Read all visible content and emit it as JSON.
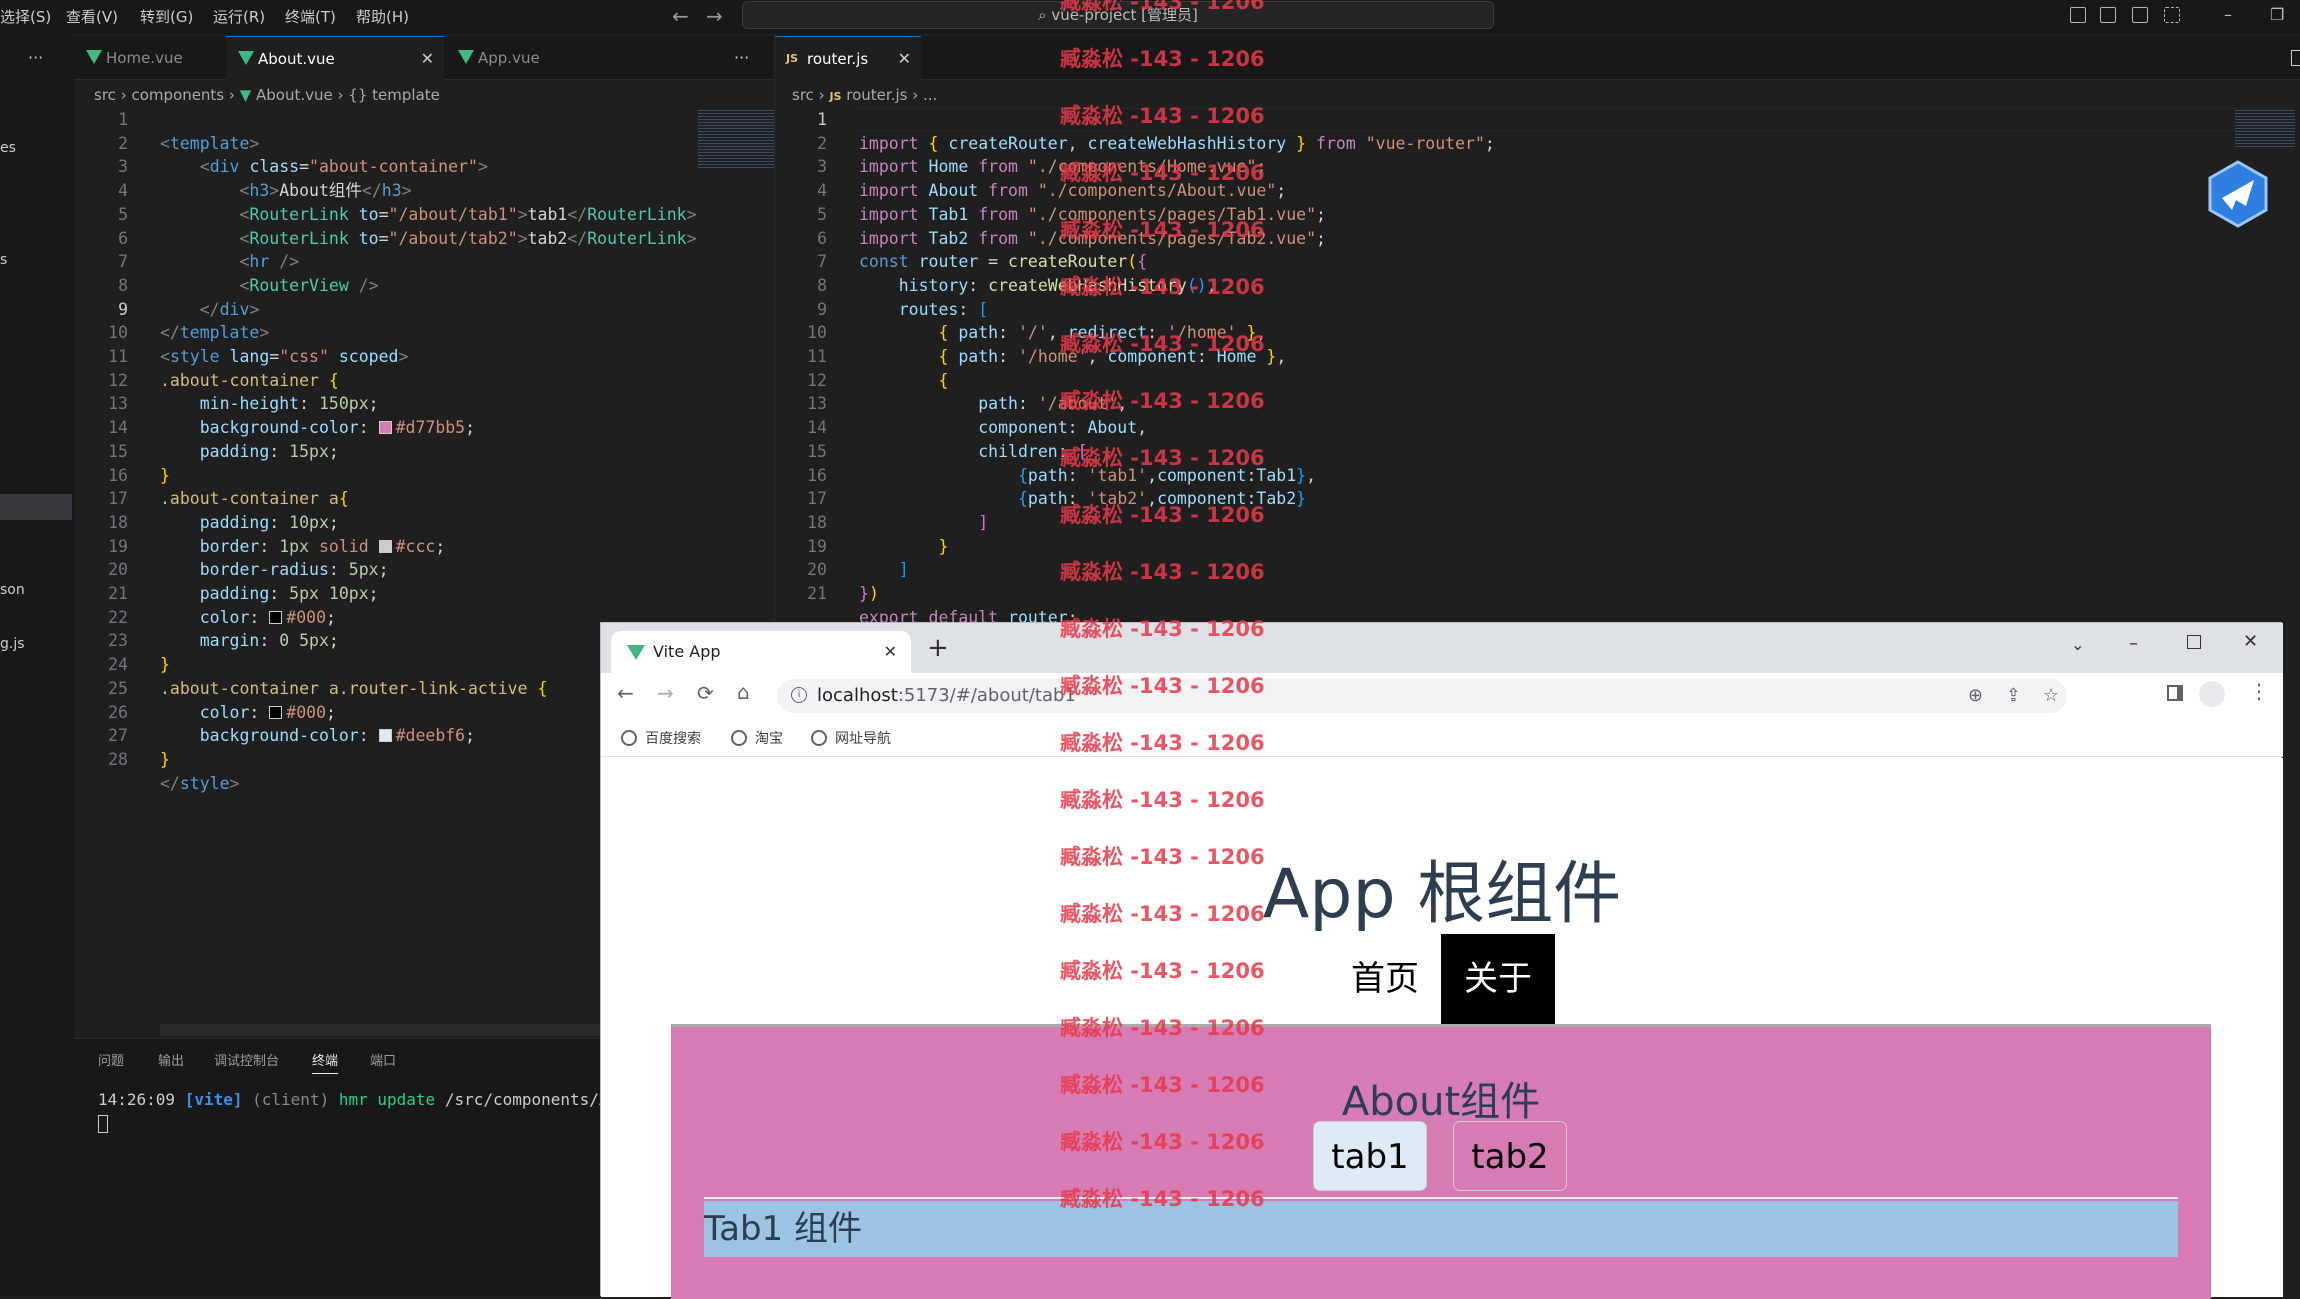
{
  "menu": {
    "items": [
      "选择(S)",
      "查看(V)",
      "转到(G)",
      "运行(R)",
      "终端(T)",
      "帮助(H)"
    ],
    "command_center": "vue-project [管理员]"
  },
  "left_editor": {
    "tabs": [
      {
        "label": "Home.vue"
      },
      {
        "label": "About.vue"
      },
      {
        "label": "App.vue"
      }
    ],
    "breadcrumb": {
      "p1": "src",
      "p2": "components",
      "p3": "About.vue",
      "p4": "{} template"
    },
    "lines": [
      "1",
      "2",
      "3",
      "4",
      "5",
      "6",
      "7",
      "8",
      "9",
      "10",
      "11",
      "12",
      "13",
      "14",
      "15",
      "16",
      "17",
      "18",
      "19",
      "20",
      "21",
      "22",
      "23",
      "24",
      "25",
      "26",
      "27",
      "28"
    ],
    "colors": {
      "about_bg": "#d77bb5",
      "border": "#ccc",
      "text": "#000",
      "active_bg": "#deebf6"
    }
  },
  "right_editor": {
    "tab": "router.js",
    "breadcrumb": {
      "p1": "src",
      "p2": "router.js",
      "p3": "..."
    },
    "lines": [
      "1",
      "2",
      "3",
      "4",
      "5",
      "6",
      "7",
      "8",
      "9",
      "10",
      "11",
      "12",
      "13",
      "14",
      "15",
      "16",
      "17",
      "18",
      "19",
      "20",
      "21"
    ]
  },
  "sidebar": {
    "peek": [
      "es",
      "s",
      "son",
      "g.js"
    ]
  },
  "panel": {
    "tabs": [
      "问题",
      "输出",
      "调试控制台",
      "终端",
      "端口"
    ],
    "time": "14:26:09",
    "vite": "[vite]",
    "client": "(client)",
    "hmr": "hmr update",
    "path": "/src/components/Abou"
  },
  "browser": {
    "tab_title": "Vite App",
    "new_tab": "+",
    "url_host": "localhost",
    "url_rest": ":5173/#/about/tab1",
    "bookmarks": [
      "百度搜索",
      "淘宝",
      "网址导航"
    ],
    "page": {
      "title": "App 根组件",
      "nav": [
        "首页",
        "关于"
      ],
      "about_heading": "About组件",
      "tabs": [
        "tab1",
        "tab2"
      ],
      "tab_content": "Tab1 组件"
    },
    "colors": {
      "about_bg": "#d77bb5",
      "active_tab_bg": "#deebf6",
      "tab1_content_bg": "#9cc3e4"
    }
  },
  "watermark": {
    "text": "臧淼松 -143 - 1206"
  }
}
